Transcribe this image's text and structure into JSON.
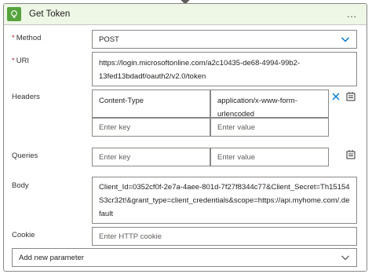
{
  "header": {
    "title": "Get Token",
    "icon": "lightbulb-icon",
    "more": "...",
    "accent": "#56a33d"
  },
  "fields": {
    "method": {
      "label": "Method",
      "required": "*",
      "value": "POST"
    },
    "uri": {
      "label": "URI",
      "required": "*",
      "value": "https://login.microsoftonline.com/a2c10435-de68-4994-99b2-13fed13bdadf/oauth2/v2.0/token"
    },
    "headers": {
      "label": "Headers",
      "key": "Content-Type",
      "value": "application/x-www-form-urlencoded",
      "key_placeholder": "Enter key",
      "value_placeholder": "Enter value"
    },
    "queries": {
      "label": "Queries",
      "key_placeholder": "Enter key",
      "value_placeholder": "Enter value"
    },
    "body": {
      "label": "Body",
      "value": "Client_Id=0352cf0f-2e7a-4aee-801d-7f27f8344c77&Client_Secret=Th15154S3cr32t!&grant_type=client_credentials&scope=https://api.myhome.com/.default"
    },
    "cookie": {
      "label": "Cookie",
      "placeholder": "Enter HTTP cookie"
    }
  },
  "add_param": {
    "label": "Add new parameter"
  }
}
